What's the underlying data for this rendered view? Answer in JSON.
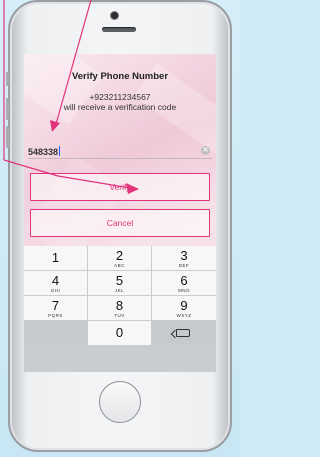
{
  "dialog": {
    "title": "Verify Phone Number",
    "phone": "+923211234567",
    "message": "will receive a verification code"
  },
  "input": {
    "value": "548338",
    "clear_icon": "clear-circle-icon"
  },
  "buttons": {
    "verify": "Verify",
    "cancel": "Cancel"
  },
  "keypad": {
    "keys": [
      {
        "num": "1",
        "sub": ""
      },
      {
        "num": "2",
        "sub": "ABC"
      },
      {
        "num": "3",
        "sub": "DEF"
      },
      {
        "num": "4",
        "sub": "GHI"
      },
      {
        "num": "5",
        "sub": "JKL"
      },
      {
        "num": "6",
        "sub": "MNO"
      },
      {
        "num": "7",
        "sub": "PQRS"
      },
      {
        "num": "8",
        "sub": "TUV"
      },
      {
        "num": "9",
        "sub": "WXYZ"
      },
      {
        "num": "0",
        "sub": ""
      }
    ],
    "backspace_icon": "backspace-icon"
  },
  "colors": {
    "accent": "#e0337b",
    "background": "#cfeaf5"
  }
}
